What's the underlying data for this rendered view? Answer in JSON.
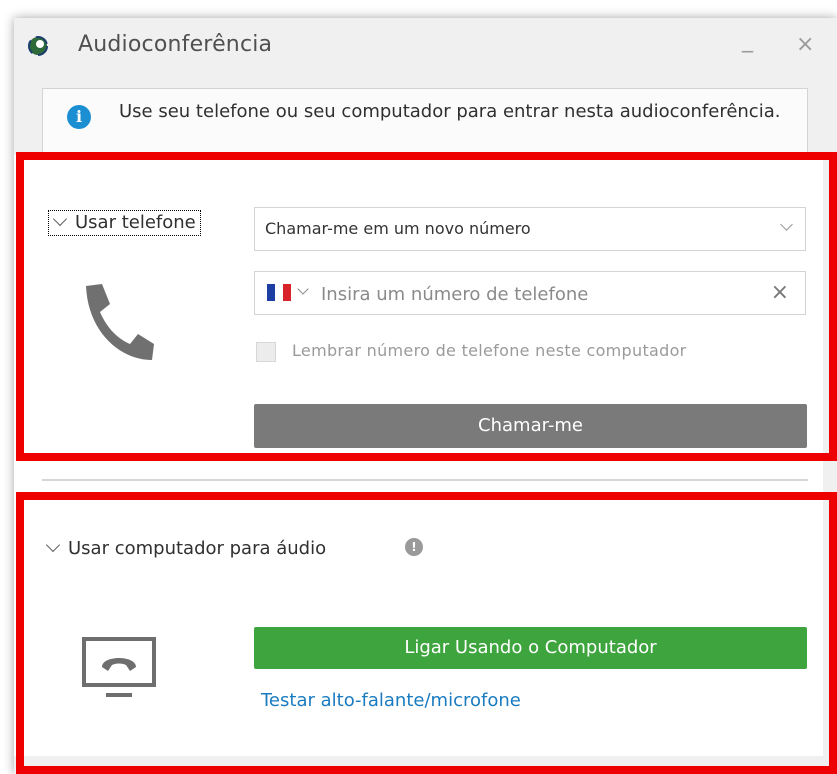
{
  "window": {
    "title": "Audioconferência",
    "minimize_glyph": "_",
    "close_glyph": "×"
  },
  "info": {
    "icon": "info-icon",
    "text": "Use seu telefone ou seu computador para entrar nesta audioconferência."
  },
  "phone_section": {
    "label": "Usar telefone",
    "dropdown_value": "Chamar-me em um novo número",
    "phone_input": {
      "value": "",
      "placeholder": "Insira um número de telefone",
      "flag": "France"
    },
    "remember_checkbox": {
      "label": "Lembrar número de telefone neste computador",
      "checked": false
    },
    "call_button_label": "Chamar-me",
    "icon": "phone-handset-icon"
  },
  "computer_section": {
    "label": "Usar computador para áudio",
    "connect_button_label": "Ligar Usando o Computador",
    "test_link_label": "Testar alto-falante/microfone",
    "icon": "computer-audio-icon"
  },
  "colors": {
    "accent_blue": "#1b8fd2",
    "call_button": "#7a7a7a",
    "connect_button": "#3ea53e",
    "link": "#1a7bc0",
    "highlight_red": "#ee0000"
  }
}
